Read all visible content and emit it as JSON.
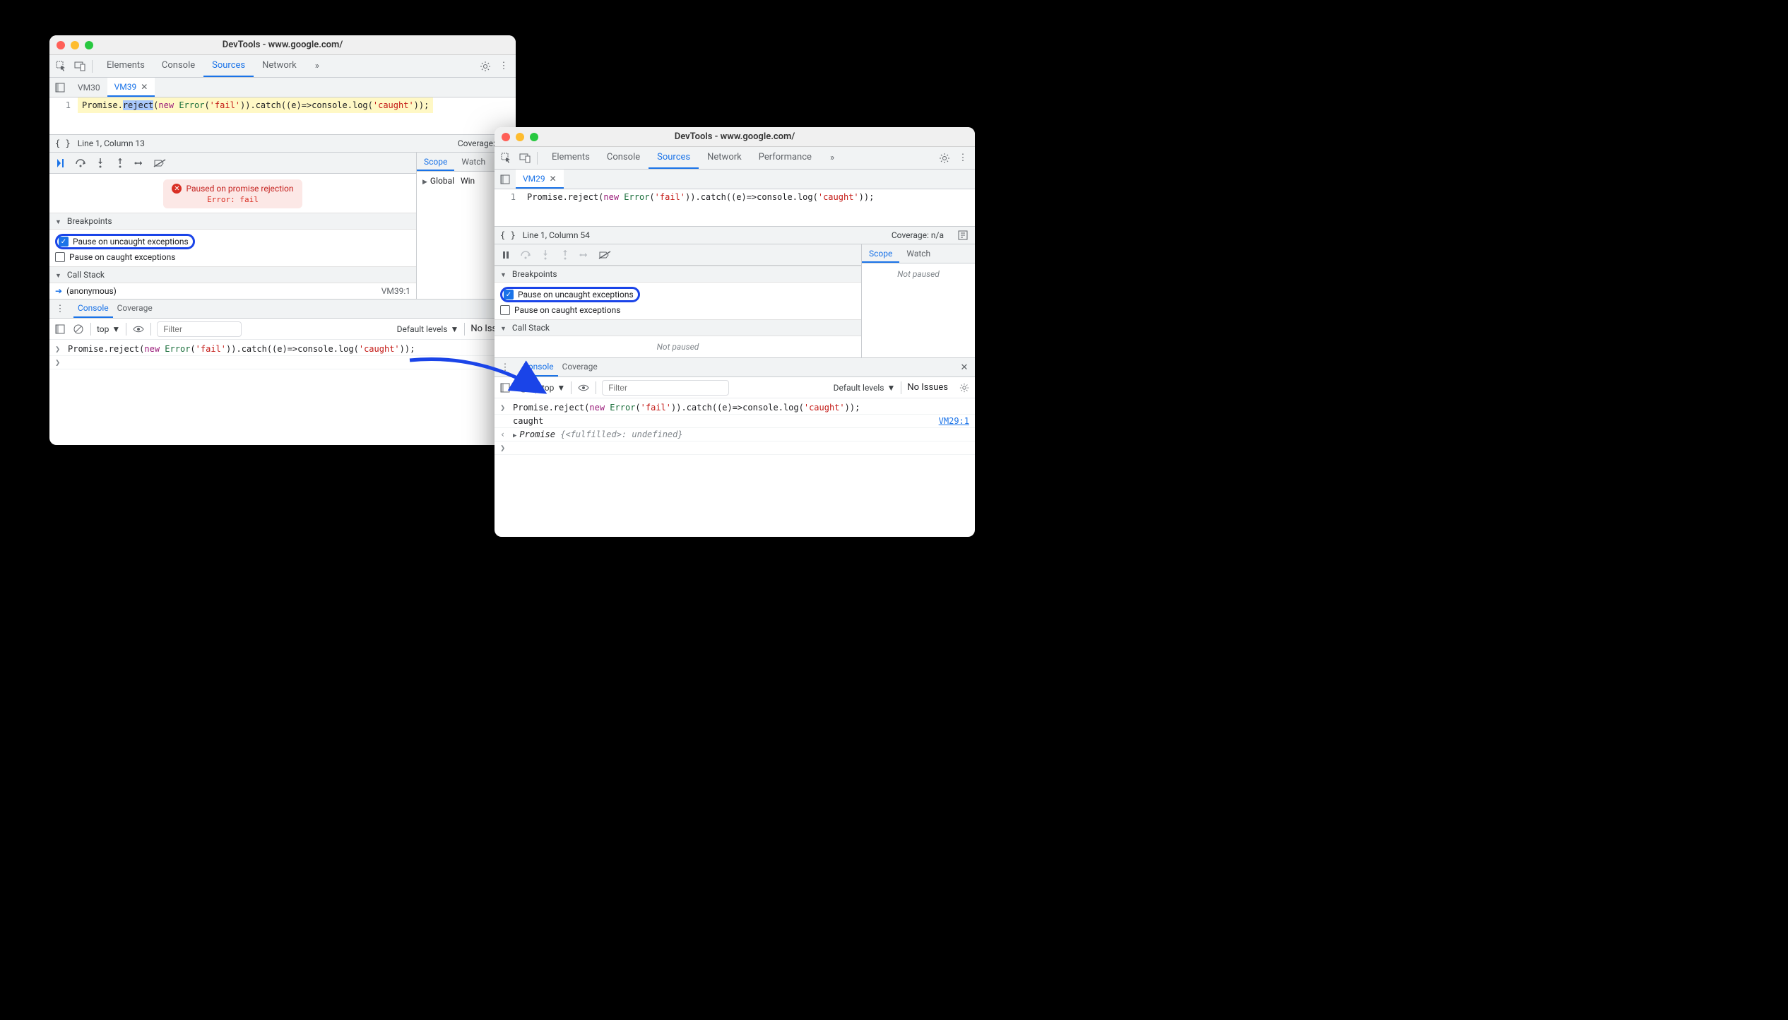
{
  "left": {
    "title": "DevTools - www.google.com/",
    "main_tabs": [
      "Elements",
      "Console",
      "Sources",
      "Network"
    ],
    "main_active": 2,
    "file_tabs": [
      {
        "name": "VM30",
        "active": false,
        "closable": false
      },
      {
        "name": "VM39",
        "active": true,
        "closable": true
      }
    ],
    "code": {
      "line_no": "1",
      "segments": [
        {
          "t": "Promise.",
          "c": ""
        },
        {
          "t": "reject",
          "c": "sel"
        },
        {
          "t": "(",
          "c": ""
        },
        {
          "t": "new",
          "c": "tok-kw"
        },
        {
          "t": " ",
          "c": ""
        },
        {
          "t": "Error",
          "c": "tok-type"
        },
        {
          "t": "(",
          "c": ""
        },
        {
          "t": "'fail'",
          "c": "tok-str"
        },
        {
          "t": ")).catch((e)=>console.log(",
          "c": ""
        },
        {
          "t": "'caught'",
          "c": "tok-str"
        },
        {
          "t": "));",
          "c": ""
        }
      ]
    },
    "status_line": "Line 1, Column 13",
    "coverage": "Coverage: n/a",
    "pause_banner": {
      "title": "Paused on promise rejection",
      "detail": "Error: fail"
    },
    "breakpoints": {
      "header": "Breakpoints",
      "uncaught": {
        "label": "Pause on uncaught exceptions",
        "checked": true,
        "highlight": true
      },
      "caught": {
        "label": "Pause on caught exceptions",
        "checked": false
      }
    },
    "callstack": {
      "header": "Call Stack",
      "frames": [
        {
          "name": "(anonymous)",
          "loc": "VM39:1"
        }
      ]
    },
    "scope": {
      "tabs": [
        "Scope",
        "Watch"
      ],
      "active": 0,
      "rows": [
        {
          "label": "Global",
          "value": "Win"
        }
      ]
    },
    "drawer": {
      "tabs": [
        "Console",
        "Coverage"
      ],
      "active": 0,
      "context": "top",
      "filter_placeholder": "Filter",
      "levels": "Default levels",
      "issues": "No Issues",
      "console_rows": [
        {
          "kind": "input",
          "code_segments": [
            {
              "t": "Promise.reject(",
              "c": ""
            },
            {
              "t": "new",
              "c": "tok-kw"
            },
            {
              "t": " ",
              "c": ""
            },
            {
              "t": "Error",
              "c": "tok-type"
            },
            {
              "t": "(",
              "c": ""
            },
            {
              "t": "'fail'",
              "c": "tok-str"
            },
            {
              "t": ")).catch((e)=>console.log(",
              "c": ""
            },
            {
              "t": "'caught'",
              "c": "tok-str"
            },
            {
              "t": "));",
              "c": ""
            }
          ]
        }
      ]
    }
  },
  "right": {
    "title": "DevTools - www.google.com/",
    "main_tabs": [
      "Elements",
      "Console",
      "Sources",
      "Network",
      "Performance"
    ],
    "main_active": 2,
    "file_tabs": [
      {
        "name": "VM29",
        "active": true,
        "closable": true
      }
    ],
    "code": {
      "line_no": "1",
      "segments": [
        {
          "t": "Promise.reject(",
          "c": ""
        },
        {
          "t": "new",
          "c": "tok-kw"
        },
        {
          "t": " ",
          "c": ""
        },
        {
          "t": "Error",
          "c": "tok-type"
        },
        {
          "t": "(",
          "c": ""
        },
        {
          "t": "'fail'",
          "c": "tok-str"
        },
        {
          "t": ")).catch((e)=>console.log(",
          "c": ""
        },
        {
          "t": "'caught'",
          "c": "tok-str"
        },
        {
          "t": "));",
          "c": ""
        }
      ]
    },
    "status_line": "Line 1, Column 54",
    "coverage": "Coverage: n/a",
    "breakpoints": {
      "header": "Breakpoints",
      "uncaught": {
        "label": "Pause on uncaught exceptions",
        "checked": true,
        "highlight": true
      },
      "caught": {
        "label": "Pause on caught exceptions",
        "checked": false
      }
    },
    "callstack": {
      "header": "Call Stack",
      "not_paused": "Not paused"
    },
    "scope": {
      "tabs": [
        "Scope",
        "Watch"
      ],
      "active": 0,
      "not_paused": "Not paused"
    },
    "drawer": {
      "tabs": [
        "Console",
        "Coverage"
      ],
      "active": 0,
      "context": "top",
      "filter_placeholder": "Filter",
      "levels": "Default levels",
      "issues": "No Issues",
      "console_rows": [
        {
          "kind": "input",
          "code_segments": [
            {
              "t": "Promise.reject(",
              "c": ""
            },
            {
              "t": "new",
              "c": "tok-kw"
            },
            {
              "t": " ",
              "c": ""
            },
            {
              "t": "Error",
              "c": "tok-type"
            },
            {
              "t": "(",
              "c": ""
            },
            {
              "t": "'fail'",
              "c": "tok-str"
            },
            {
              "t": ")).catch((e)=>console.log(",
              "c": ""
            },
            {
              "t": "'caught'",
              "c": "tok-str"
            },
            {
              "t": "));",
              "c": ""
            }
          ]
        },
        {
          "kind": "log",
          "text": "caught",
          "link": "VM29:1"
        },
        {
          "kind": "result",
          "prefix": "Promise ",
          "body": "{<fulfilled>: undefined}"
        }
      ]
    }
  }
}
